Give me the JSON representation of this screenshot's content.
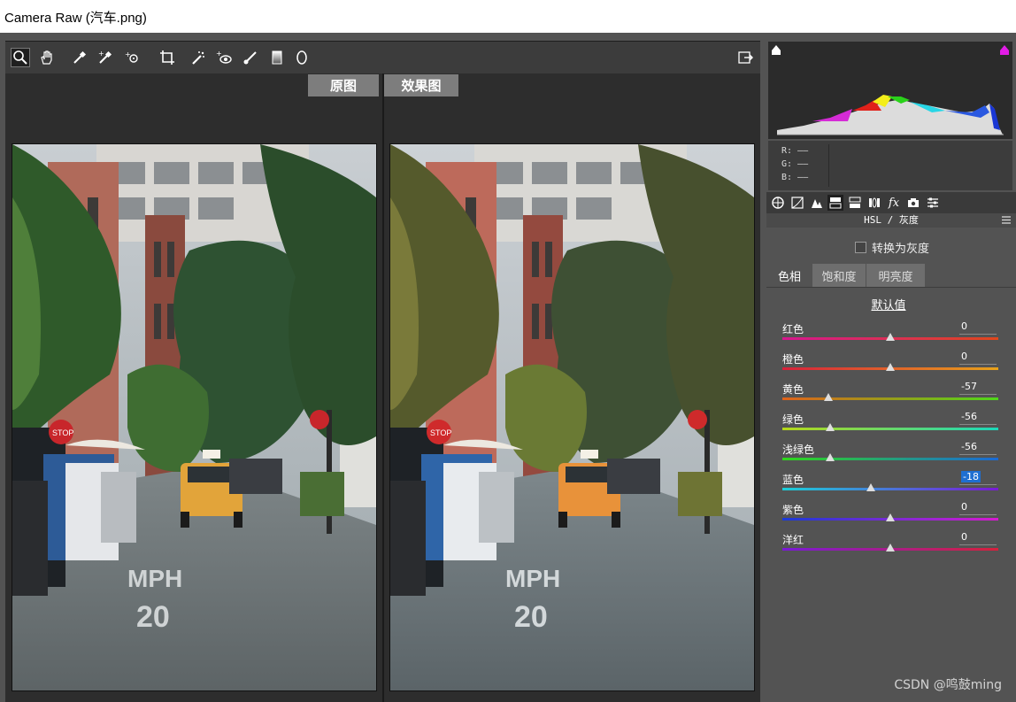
{
  "window": {
    "title": "Camera Raw (汽车.png)"
  },
  "toolbar": {
    "tools": [
      "zoom-icon",
      "hand-icon",
      "white-balance-icon",
      "color-sampler-icon",
      "targeted-adjust-icon",
      "crop-icon",
      "spot-removal-icon",
      "red-eye-icon",
      "adjustment-brush-icon",
      "graduated-filter-icon",
      "radial-filter-icon"
    ],
    "export_icon": "open-preferences-icon"
  },
  "compare": {
    "before_label": "原图",
    "after_label": "效果图"
  },
  "histogram": {
    "readout": {
      "r": "R: ——",
      "g": "G: ——",
      "b": "B: ——"
    }
  },
  "panel": {
    "title": "HSL / 灰度",
    "grayscale_label": "转换为灰度",
    "subtabs": [
      "色相",
      "饱和度",
      "明亮度"
    ],
    "default_label": "默认值",
    "sliders": [
      {
        "label": "红色",
        "value": "0",
        "amount": 0
      },
      {
        "label": "橙色",
        "value": "0",
        "amount": 0
      },
      {
        "label": "黄色",
        "value": "-57",
        "amount": -57
      },
      {
        "label": "绿色",
        "value": "-56",
        "amount": -56
      },
      {
        "label": "浅绿色",
        "value": "-56",
        "amount": -56
      },
      {
        "label": "蓝色",
        "value": "-18",
        "amount": -18
      },
      {
        "label": "紫色",
        "value": "0",
        "amount": 0
      },
      {
        "label": "洋红",
        "value": "0",
        "amount": 0
      }
    ]
  },
  "watermark": "CSDN @鸣鼓ming"
}
